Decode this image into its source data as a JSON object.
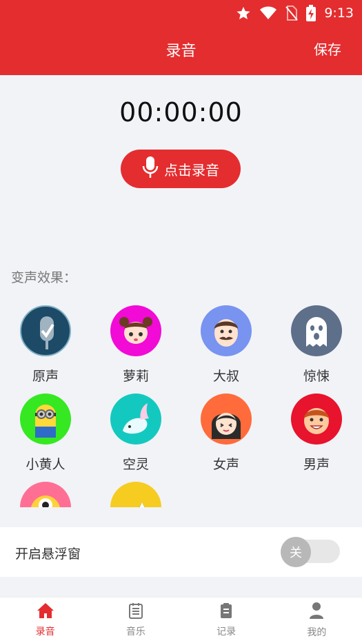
{
  "status_bar": {
    "time": "9:13"
  },
  "header": {
    "title": "录音",
    "save_label": "保存"
  },
  "timer": "00:00:00",
  "record_button": {
    "label": "点击录音"
  },
  "effects": {
    "section_label": "变声效果：",
    "items": [
      {
        "label": "原声",
        "icon": "microphone-check-icon",
        "color": "#1d4a66"
      },
      {
        "label": "萝莉",
        "icon": "loli-girl-icon",
        "color": "#f20ad6"
      },
      {
        "label": "大叔",
        "icon": "uncle-face-icon",
        "color": "#7893f0"
      },
      {
        "label": "惊悚",
        "icon": "ghost-icon",
        "color": "#5e6f8a"
      },
      {
        "label": "小黄人",
        "icon": "minion-icon",
        "color": "#35e822"
      },
      {
        "label": "空灵",
        "icon": "ethereal-fish-icon",
        "color": "#13c9bf"
      },
      {
        "label": "女声",
        "icon": "female-face-icon",
        "color": "#ff6b3a"
      },
      {
        "label": "男声",
        "icon": "male-face-icon",
        "color": "#e8132c"
      },
      {
        "label": "",
        "icon": "monster-icon",
        "color": "#ff6f94"
      },
      {
        "label": "",
        "icon": "mountain-icon",
        "color": "#f6cc20"
      }
    ]
  },
  "float_window": {
    "label": "开启悬浮窗",
    "toggle_text": "关",
    "enabled": false
  },
  "bottom_nav": {
    "items": [
      {
        "label": "录音",
        "icon": "home-icon",
        "active": true
      },
      {
        "label": "音乐",
        "icon": "music-list-icon",
        "active": false
      },
      {
        "label": "记录",
        "icon": "record-list-icon",
        "active": false
      },
      {
        "label": "我的",
        "icon": "user-icon",
        "active": false
      }
    ]
  },
  "colors": {
    "accent": "#e42d2f",
    "background": "#f1f3f7"
  }
}
